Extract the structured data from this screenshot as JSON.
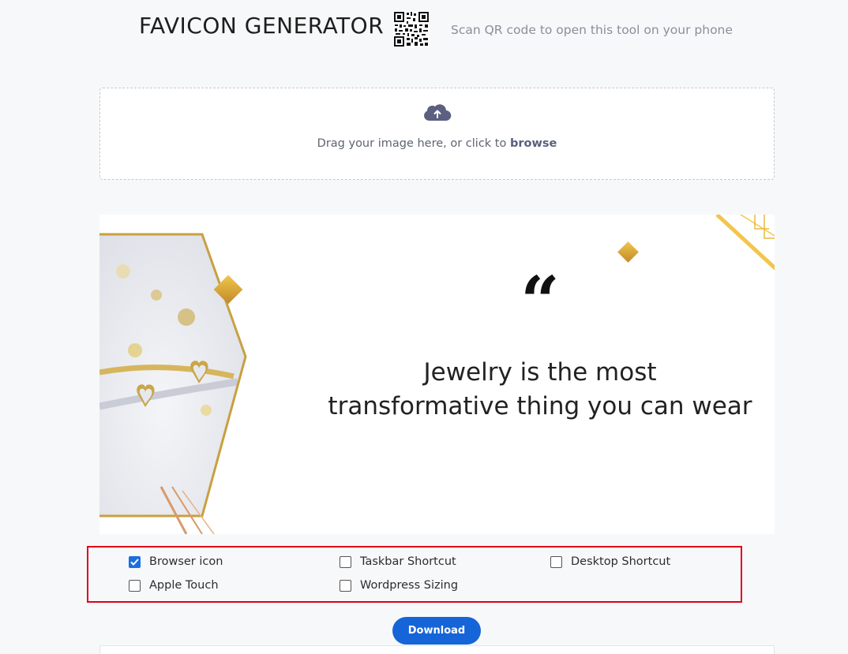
{
  "header": {
    "title": "FAVICON GENERATOR",
    "qr_caption": "Scan QR code to open this tool on your phone"
  },
  "dropzone": {
    "text_prefix": "Drag your image here, or click to ",
    "browse_label": "browse",
    "icon": "cloud-upload-icon"
  },
  "preview": {
    "quote_mark": "“",
    "quote_line1": "Jewelry is the most",
    "quote_line2": "transformative thing you can wear"
  },
  "options": [
    {
      "label": "Browser icon",
      "checked": true
    },
    {
      "label": "Taskbar Shortcut",
      "checked": false
    },
    {
      "label": "Desktop Shortcut",
      "checked": false
    },
    {
      "label": "Apple Touch",
      "checked": false
    },
    {
      "label": "Wordpress Sizing",
      "checked": false
    }
  ],
  "actions": {
    "download_label": "Download"
  },
  "colors": {
    "accent": "#1565d8",
    "highlight_border": "#e0001a",
    "gold": "#d4a437"
  }
}
